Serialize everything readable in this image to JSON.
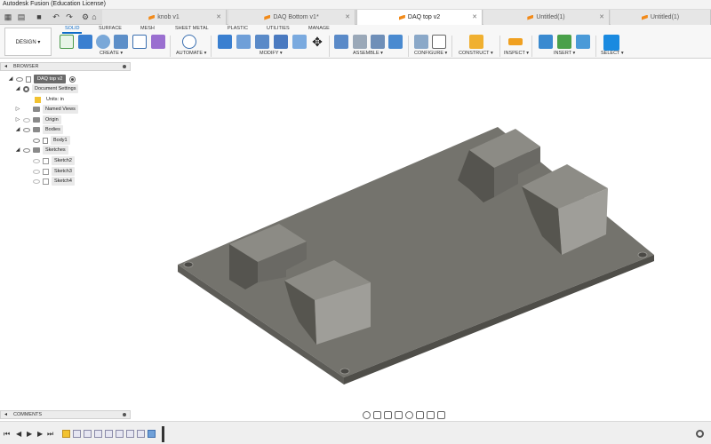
{
  "app": {
    "title": "Autodesk Fusion (Education License)"
  },
  "tabs": [
    {
      "label": "knob v1",
      "active": false
    },
    {
      "label": "DAQ Bottom v1*",
      "active": false
    },
    {
      "label": "DAQ top v2",
      "active": true
    },
    {
      "label": "Untitled(1)",
      "active": false
    },
    {
      "label": "Untitled(1)",
      "active": false
    }
  ],
  "toolbar": {
    "workspace": "DESIGN ▾",
    "workspace_tabs": [
      "SOLID",
      "SURFACE",
      "MESH",
      "SHEET METAL",
      "PLASTIC",
      "UTILITIES",
      "MANAGE"
    ],
    "groups": [
      "CREATE ▾",
      "AUTOMATE ▾",
      "MODIFY ▾",
      "ASSEMBLE ▾",
      "CONFIGURE ▾",
      "CONSTRUCT ▾",
      "INSPECT ▾",
      "INSERT ▾",
      "SELECT ▾"
    ]
  },
  "browser": {
    "title": "BROWSER",
    "document": "DAQ top v2",
    "items": [
      {
        "label": "Document Settings"
      },
      {
        "label": "Units: in"
      },
      {
        "label": "Named Views"
      },
      {
        "label": "Origin"
      },
      {
        "label": "Bodies"
      },
      {
        "label": "Body1"
      },
      {
        "label": "Sketches"
      },
      {
        "label": "Sketch2"
      },
      {
        "label": "Sketch3"
      },
      {
        "label": "Sketch4"
      }
    ]
  },
  "comments": {
    "title": "COMMENTS"
  },
  "colors": {
    "accent": "#0f6cc7",
    "model_face": "#6b6a64",
    "model_top": "#77766f"
  }
}
